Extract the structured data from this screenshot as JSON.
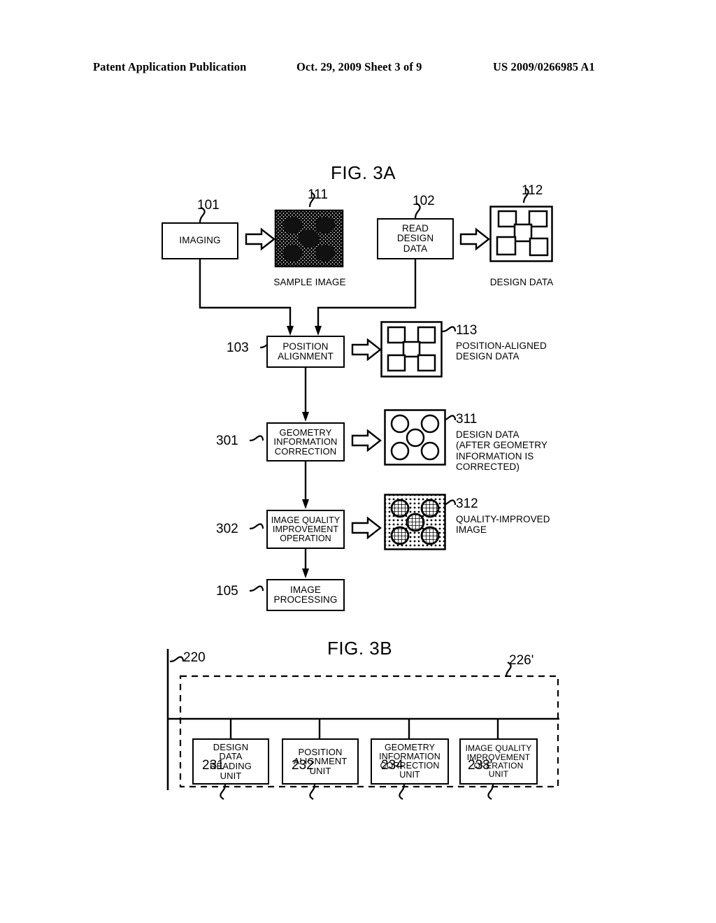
{
  "header": {
    "publication": "Patent Application Publication",
    "date_sheet": "Oct. 29, 2009  Sheet 3 of 9",
    "patent_number": "US 2009/0266985 A1"
  },
  "figures": [
    {
      "id": "fig-3a",
      "title": "FIG. 3A",
      "blocks": [
        {
          "ref": "101",
          "label": "IMAGING"
        },
        {
          "ref": "102",
          "label": "READ\nDESIGN\nDATA"
        },
        {
          "ref": "103",
          "label": "POSITION\nALIGNMENT"
        },
        {
          "ref": "301",
          "label": "GEOMETRY\nINFORMATION\nCORRECTION"
        },
        {
          "ref": "302",
          "label": "IMAGE QUALITY\nIMPROVEMENT\nOPERATION"
        },
        {
          "ref": "105",
          "label": "IMAGE\nPROCESSING"
        }
      ],
      "thumbnails": [
        {
          "ref": "111",
          "caption": "SAMPLE IMAGE",
          "kind": "noisy-blobs"
        },
        {
          "ref": "112",
          "caption": "DESIGN DATA",
          "kind": "squares-misaligned"
        },
        {
          "ref": "113",
          "caption": "POSITION-ALIGNED\nDESIGN DATA",
          "kind": "squares-aligned"
        },
        {
          "ref": "311",
          "caption": "DESIGN DATA\n(AFTER GEOMETRY\nINFORMATION IS\nCORRECTED)",
          "kind": "circles"
        },
        {
          "ref": "312",
          "caption": "QUALITY-IMPROVED\nIMAGE",
          "kind": "dotted-hatched-circles"
        }
      ]
    },
    {
      "id": "fig-3b",
      "title": "FIG. 3B",
      "bus_ref": "220",
      "group_ref": "226'",
      "units": [
        {
          "ref": "231",
          "label": "DESIGN\nDATA\nREADING\nUNIT"
        },
        {
          "ref": "232",
          "label": "POSITION\nALIGNMENT\nUNIT"
        },
        {
          "ref": "234",
          "label": "GEOMETRY\nINFORMATION\nCORRECTION\nUNIT"
        },
        {
          "ref": "233'",
          "label": "IMAGE QUALITY\nIMPROVEMENT\nOPERATION\nUNIT"
        }
      ]
    }
  ],
  "colors": {
    "ink": "#000000",
    "paper": "#ffffff"
  }
}
